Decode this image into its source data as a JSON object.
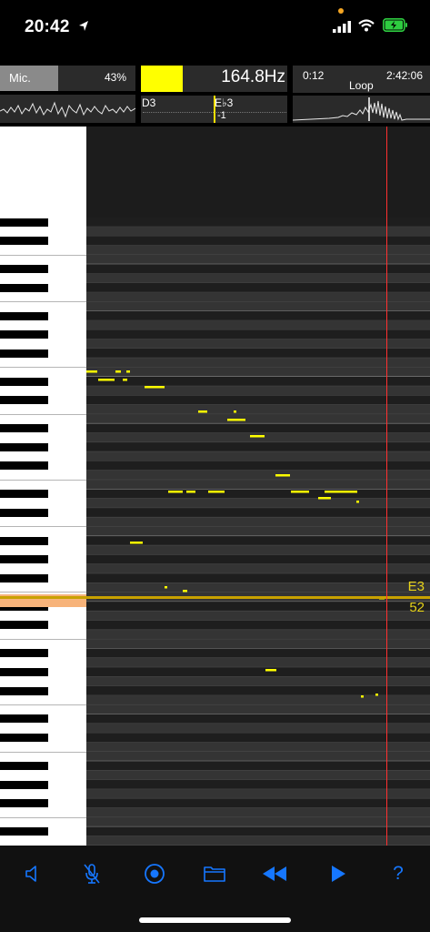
{
  "status_bar": {
    "time": "20:42"
  },
  "mic_panel": {
    "label": "Mic.",
    "level": "43%"
  },
  "frequency_panel": {
    "value": "164.8Hz",
    "color": "#ffff00"
  },
  "tuner_panel": {
    "left_note": "D3",
    "center_note": "E♭3",
    "cents": "-1"
  },
  "time_panel": {
    "position": "0:12",
    "duration": "2:42:06",
    "loop_label": "Loop"
  },
  "current_note": {
    "name": "E3",
    "midi": "52"
  },
  "toolbar": {
    "items": [
      "speaker-button",
      "mic-mute-button",
      "record-button",
      "folder-button",
      "rewind-button",
      "play-button",
      "help-button"
    ],
    "help_label": "?"
  },
  "colors": {
    "accent": "#1677ff",
    "pitch": "#ffff00",
    "playhead": "#ff3030",
    "highlight_key": "#f7b37a"
  }
}
